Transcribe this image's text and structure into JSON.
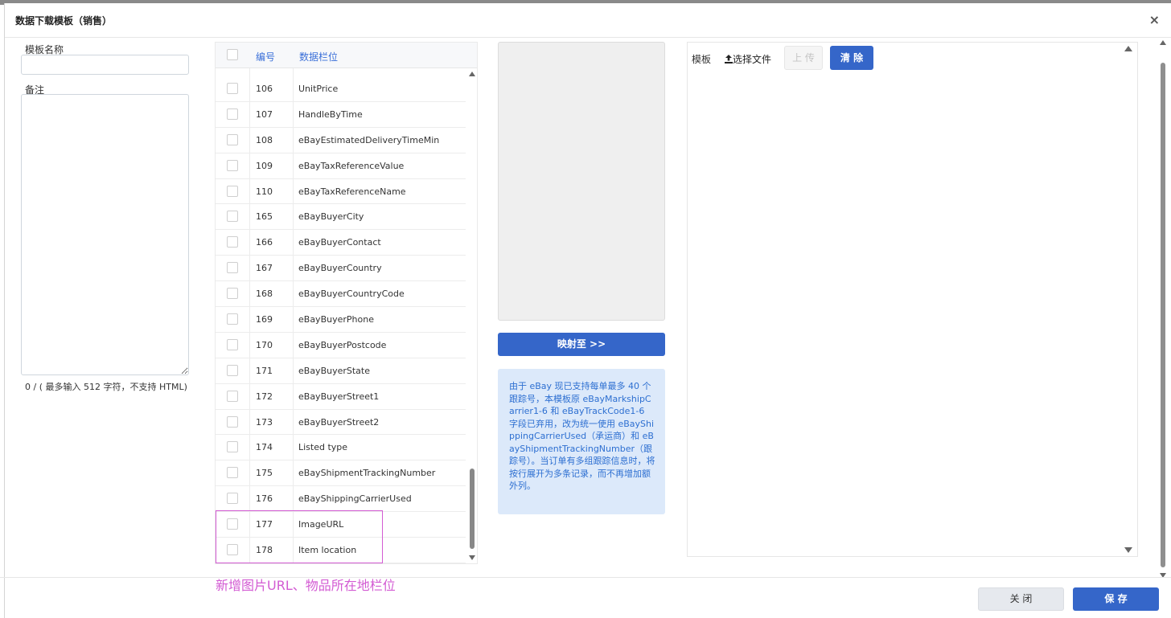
{
  "modal": {
    "title": "数据下载模板（销售）",
    "close_icon": "×"
  },
  "form": {
    "name_label": "模板名称",
    "name_value": "",
    "remark_label": "备注",
    "remark_value": "",
    "remark_hint": "0 / ( 最多输入 512 字符，不支持 HTML)"
  },
  "table": {
    "headers": {
      "number": "编号",
      "field": "数据栏位"
    },
    "rows": [
      {
        "number": "106",
        "field": "UnitPrice"
      },
      {
        "number": "107",
        "field": "HandleByTime"
      },
      {
        "number": "108",
        "field": "eBayEstimatedDeliveryTimeMin"
      },
      {
        "number": "109",
        "field": "eBayTaxReferenceValue"
      },
      {
        "number": "110",
        "field": "eBayTaxReferenceName"
      },
      {
        "number": "165",
        "field": "eBayBuyerCity"
      },
      {
        "number": "166",
        "field": "eBayBuyerContact"
      },
      {
        "number": "167",
        "field": "eBayBuyerCountry"
      },
      {
        "number": "168",
        "field": "eBayBuyerCountryCode"
      },
      {
        "number": "169",
        "field": "eBayBuyerPhone"
      },
      {
        "number": "170",
        "field": "eBayBuyerPostcode"
      },
      {
        "number": "171",
        "field": "eBayBuyerState"
      },
      {
        "number": "172",
        "field": "eBayBuyerStreet1"
      },
      {
        "number": "173",
        "field": "eBayBuyerStreet2"
      },
      {
        "number": "174",
        "field": "Listed type"
      },
      {
        "number": "175",
        "field": "eBayShipmentTrackingNumber"
      },
      {
        "number": "176",
        "field": "eBayShippingCarrierUsed"
      },
      {
        "number": "177",
        "field": "ImageURL"
      },
      {
        "number": "178",
        "field": "Item location"
      }
    ]
  },
  "annotation": "新增图片URL、物品所在地栏位",
  "mapping": {
    "button_label": "映射至 >>",
    "info_text": "由于 eBay 现已支持每单最多 40 个跟踪号，本模板原 eBayMarkshipCarrier1-6 和 eBayTrackCode1-6 字段已弃用，改为统一使用 eBayShippingCarrierUsed（承运商）和 eBayShipmentTrackingNumber（跟踪号）。当订单有多组跟踪信息时，将按行展开为多条记录，而不再增加额外列。"
  },
  "upload": {
    "template_label": "模板",
    "choose_file_label": "选择文件",
    "upload_label": "上 传",
    "clear_label": "清 除"
  },
  "footer": {
    "close_label": "关 闭",
    "save_label": "保 存"
  },
  "colors": {
    "primary": "#3566c9",
    "annotation": "#d35bd3",
    "info_bg": "#dce9fa",
    "info_text": "#2d6fd1"
  },
  "icons": [
    "close-icon",
    "upload-icon",
    "scroll-up-icon",
    "scroll-down-icon"
  ]
}
